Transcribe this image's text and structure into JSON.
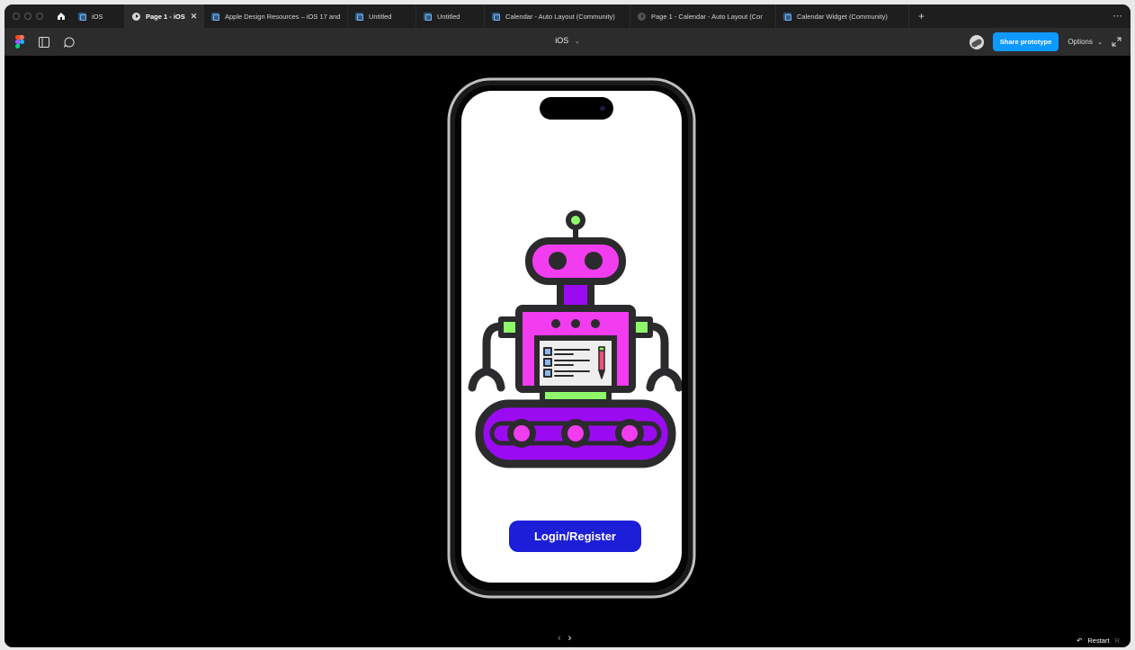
{
  "tabs": [
    {
      "label": "iOS",
      "kind": "file",
      "active": false
    },
    {
      "label": "Page 1 - iOS",
      "kind": "prototype",
      "active": true
    },
    {
      "label": "Apple Design Resources – iOS 17 and",
      "kind": "file",
      "active": false
    },
    {
      "label": "Untitled",
      "kind": "file",
      "active": false
    },
    {
      "label": "Untitled",
      "kind": "file",
      "active": false
    },
    {
      "label": "Calendar - Auto Layout (Community)",
      "kind": "file",
      "active": false
    },
    {
      "label": "Page 1 - Calendar - Auto Layout (Cor",
      "kind": "prototype",
      "active": false
    },
    {
      "label": "Calendar Widget (Community)",
      "kind": "file",
      "active": false
    }
  ],
  "toolbar": {
    "title": "iOS",
    "share_label": "Share prototype",
    "options_label": "Options"
  },
  "prototype": {
    "login_label": "Login/Register",
    "restart_label": "Restart",
    "restart_key": "R"
  },
  "colors": {
    "accent_blue": "#0d99ff",
    "login_button": "#1c1ed8",
    "robot_magenta": "#f13cf0",
    "robot_purple": "#9b0bf2",
    "robot_green": "#8ef86a",
    "robot_outline": "#2b2b2d"
  }
}
